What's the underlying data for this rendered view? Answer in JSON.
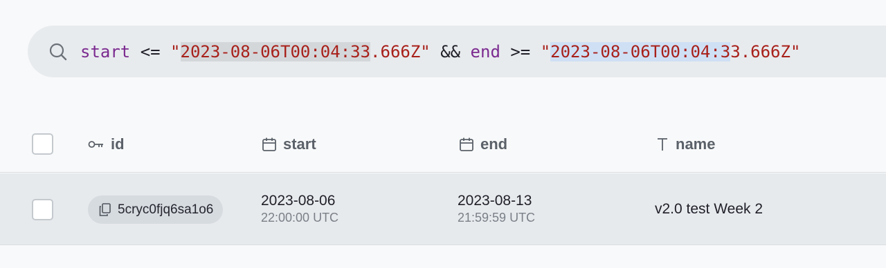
{
  "filter": {
    "kw_start": "start",
    "op_lte": " <= ",
    "value1_quote_open": "\"",
    "value1_hl": "2023-08-06T00:04:33",
    "value1_rest": ".666Z\"",
    "op_and": " && ",
    "kw_end": "end",
    "op_gte": " >= ",
    "value2_quote_open": "\"",
    "value2_hl": "2023-08-06T00:04:3",
    "value2_rest": "3.666Z\""
  },
  "table": {
    "columns": [
      {
        "label": "id",
        "icon": "key-icon"
      },
      {
        "label": "start",
        "icon": "calendar-icon"
      },
      {
        "label": "end",
        "icon": "calendar-icon"
      },
      {
        "label": "name",
        "icon": "text-type-icon"
      }
    ],
    "rows": [
      {
        "id": "5cryc0fjq6sa1o6",
        "start_date": "2023-08-06",
        "start_time": "22:00:00 UTC",
        "end_date": "2023-08-13",
        "end_time": "21:59:59 UTC",
        "name": "v2.0 test Week 2"
      }
    ]
  },
  "colors": {
    "keyword": "#7b2a8f",
    "string": "#a8201a",
    "row_background": "#e7eaed"
  }
}
